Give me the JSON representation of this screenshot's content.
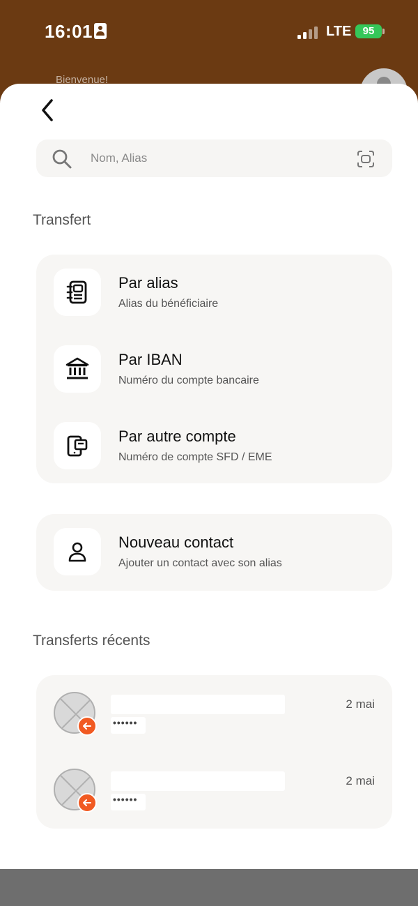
{
  "status_bar": {
    "time": "16:01",
    "network": "LTE",
    "battery": "95"
  },
  "background": {
    "welcome_text": "Bienvenue!"
  },
  "search": {
    "placeholder": "Nom, Alias"
  },
  "transfer_section": {
    "title": "Transfert",
    "options": [
      {
        "title": "Par alias",
        "subtitle": "Alias du bénéficiaire",
        "icon": "contact-book-icon"
      },
      {
        "title": "Par IBAN",
        "subtitle": "Numéro du compte bancaire",
        "icon": "bank-icon"
      },
      {
        "title": "Par autre compte",
        "subtitle": "Numéro de compte SFD / EME",
        "icon": "wallet-phone-icon"
      }
    ]
  },
  "new_contact": {
    "title": "Nouveau contact",
    "subtitle": "Ajouter un contact avec son alias",
    "icon": "person-icon"
  },
  "recent_section": {
    "title": "Transferts récents",
    "items": [
      {
        "masked": "••••••",
        "date": "2 mai"
      },
      {
        "masked": "••••••",
        "date": "2 mai"
      }
    ]
  },
  "colors": {
    "header_brown": "#6b3a12",
    "badge_orange": "#f15a22",
    "card_bg": "#f7f6f4",
    "battery_green": "#35c759"
  }
}
